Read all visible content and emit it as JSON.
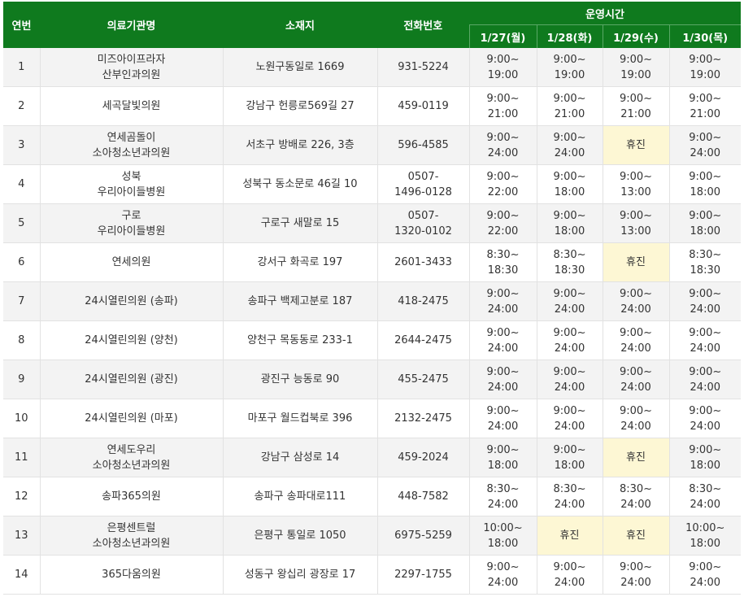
{
  "colors": {
    "header_bg": "#0f7a1e",
    "closed_bg": "#fdf7d4",
    "shaded_row": "#f3f3f3"
  },
  "headers": {
    "no": "연번",
    "name": "의료기관명",
    "address": "소재지",
    "phone": "전화번호",
    "hours": "운영시간",
    "days": [
      "1/27(월)",
      "1/28(화)",
      "1/29(수)",
      "1/30(목)"
    ]
  },
  "rows": [
    {
      "no": "1",
      "name": [
        "미즈아이프라자",
        "산부인과의원"
      ],
      "address": "노원구동일로 1669",
      "phone": [
        "931-5224"
      ],
      "hours": [
        [
          "9:00~",
          "19:00"
        ],
        [
          "9:00~",
          "19:00"
        ],
        [
          "9:00~",
          "19:00"
        ],
        [
          "9:00~",
          "19:00"
        ]
      ]
    },
    {
      "no": "2",
      "name": [
        "세곡달빛의원"
      ],
      "address": "강남구 헌릉로569길 27",
      "phone": [
        "459-0119"
      ],
      "hours": [
        [
          "9:00~",
          "21:00"
        ],
        [
          "9:00~",
          "21:00"
        ],
        [
          "9:00~",
          "21:00"
        ],
        [
          "9:00~",
          "21:00"
        ]
      ]
    },
    {
      "no": "3",
      "name": [
        "연세곰돌이",
        "소아청소년과의원"
      ],
      "address": "서초구 방배로 226, 3층",
      "phone": [
        "596-4585"
      ],
      "hours": [
        [
          "9:00~",
          "24:00"
        ],
        [
          "9:00~",
          "24:00"
        ],
        [
          "휴진"
        ],
        [
          "9:00~",
          "24:00"
        ]
      ]
    },
    {
      "no": "4",
      "name": [
        "성북",
        "우리아이들병원"
      ],
      "address": "성북구 동소문로 46길 10",
      "phone": [
        "0507-",
        "1496-0128"
      ],
      "hours": [
        [
          "9:00~",
          "22:00"
        ],
        [
          "9:00~",
          "18:00"
        ],
        [
          "9:00~",
          "13:00"
        ],
        [
          "9:00~",
          "18:00"
        ]
      ]
    },
    {
      "no": "5",
      "name": [
        "구로",
        "우리아이들병원"
      ],
      "address": "구로구 새말로 15",
      "phone": [
        "0507-",
        "1320-0102"
      ],
      "hours": [
        [
          "9:00~",
          "22:00"
        ],
        [
          "9:00~",
          "18:00"
        ],
        [
          "9:00~",
          "13:00"
        ],
        [
          "9:00~",
          "18:00"
        ]
      ]
    },
    {
      "no": "6",
      "name": [
        "연세의원"
      ],
      "address": "강서구 화곡로 197",
      "phone": [
        "2601-3433"
      ],
      "hours": [
        [
          "8:30~",
          "18:30"
        ],
        [
          "8:30~",
          "18:30"
        ],
        [
          "휴진"
        ],
        [
          "8:30~",
          "18:30"
        ]
      ]
    },
    {
      "no": "7",
      "name": [
        "24시열린의원 (송파)"
      ],
      "address": "송파구 백제고분로 187",
      "phone": [
        "418-2475"
      ],
      "hours": [
        [
          "9:00~",
          "24:00"
        ],
        [
          "9:00~",
          "24:00"
        ],
        [
          "9:00~",
          "24:00"
        ],
        [
          "9:00~",
          "24:00"
        ]
      ]
    },
    {
      "no": "8",
      "name": [
        "24시열린의원 (양천)"
      ],
      "address": "양천구 목동동로 233-1",
      "phone": [
        "2644-2475"
      ],
      "hours": [
        [
          "9:00~",
          "24:00"
        ],
        [
          "9:00~",
          "24:00"
        ],
        [
          "9:00~",
          "24:00"
        ],
        [
          "9:00~",
          "24:00"
        ]
      ]
    },
    {
      "no": "9",
      "name": [
        "24시열린의원 (광진)"
      ],
      "address": "광진구 능동로 90",
      "phone": [
        "455-2475"
      ],
      "hours": [
        [
          "9:00~",
          "24:00"
        ],
        [
          "9:00~",
          "24:00"
        ],
        [
          "9:00~",
          "24:00"
        ],
        [
          "9:00~",
          "24:00"
        ]
      ]
    },
    {
      "no": "10",
      "name": [
        "24시열린의원 (마포)"
      ],
      "address": "마포구 월드컵북로 396",
      "phone": [
        "2132-2475"
      ],
      "hours": [
        [
          "9:00~",
          "24:00"
        ],
        [
          "9:00~",
          "24:00"
        ],
        [
          "9:00~",
          "24:00"
        ],
        [
          "9:00~",
          "24:00"
        ]
      ]
    },
    {
      "no": "11",
      "name": [
        "연세도우리",
        "소아청소년과의원"
      ],
      "address": "강남구 삼성로 14",
      "phone": [
        "459-2024"
      ],
      "hours": [
        [
          "9:00~",
          "18:00"
        ],
        [
          "9:00~",
          "18:00"
        ],
        [
          "휴진"
        ],
        [
          "9:00~",
          "18:00"
        ]
      ]
    },
    {
      "no": "12",
      "name": [
        "송파365의원"
      ],
      "address": "송파구 송파대로111",
      "phone": [
        "448-7582"
      ],
      "hours": [
        [
          "8:30~",
          "24:00"
        ],
        [
          "8:30~",
          "24:00"
        ],
        [
          "8:30~",
          "24:00"
        ],
        [
          "8:30~",
          "24:00"
        ]
      ]
    },
    {
      "no": "13",
      "name": [
        "은평센트럴",
        "소아청소년과의원"
      ],
      "address": "은평구 통일로 1050",
      "phone": [
        "6975-5259"
      ],
      "hours": [
        [
          "10:00~",
          "18:00"
        ],
        [
          "휴진"
        ],
        [
          "휴진"
        ],
        [
          "10:00~",
          "18:00"
        ]
      ]
    },
    {
      "no": "14",
      "name": [
        "365다움의원"
      ],
      "address": "성동구 왕십리 광장로 17",
      "phone": [
        "2297-1755"
      ],
      "hours": [
        [
          "9:00~",
          "24:00"
        ],
        [
          "9:00~",
          "24:00"
        ],
        [
          "9:00~",
          "24:00"
        ],
        [
          "9:00~",
          "24:00"
        ]
      ]
    }
  ]
}
